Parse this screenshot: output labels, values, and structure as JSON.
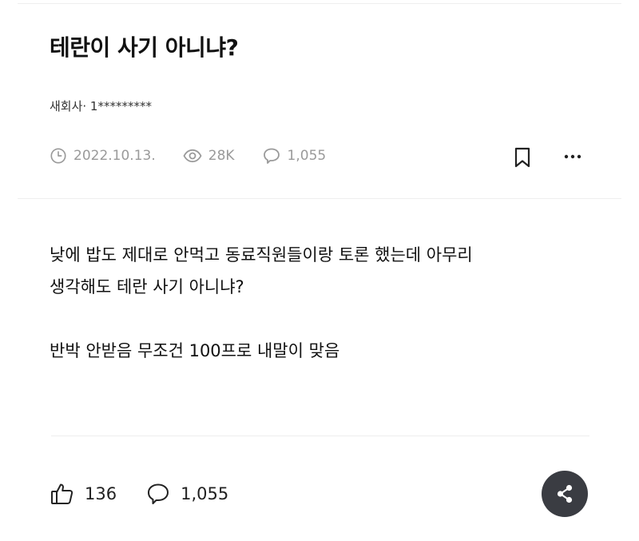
{
  "post": {
    "title": "테란이 사기 아니냐?",
    "author": "새회사· 1*********",
    "date": "2022.10.13.",
    "views": "28K",
    "comment_count": "1,055",
    "body_line_1": "낮에 밥도 제대로 안먹고 동료직원들이랑 토론 했는데 아무리",
    "body_line_2": "생각해도 테란 사기 아니냐?",
    "body_line_3": "반박 안받음 무조건 100프로 내말이 맞음"
  },
  "actions": {
    "likes": "136",
    "comments": "1,055"
  },
  "icons": {
    "date": "clock-icon",
    "views": "eye-icon",
    "comments": "speech-bubble-icon",
    "bookmark": "bookmark-icon",
    "more": "more-dots-icon",
    "like": "thumbs-up-icon",
    "share": "share-icon"
  },
  "colors": {
    "meta_text": "#9a9a9a",
    "share_button_bg": "#3a3c42"
  }
}
